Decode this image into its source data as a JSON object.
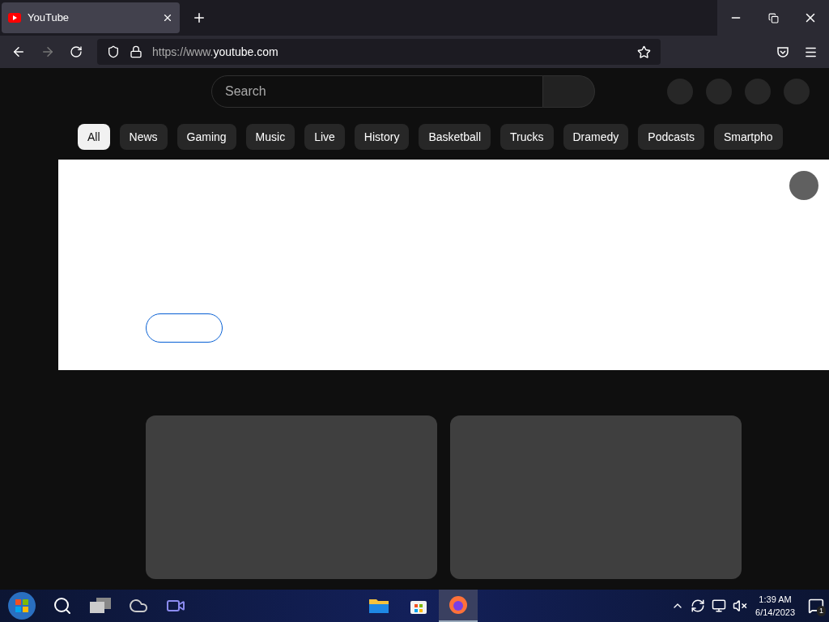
{
  "browser": {
    "tab": {
      "title": "YouTube",
      "selected": true
    },
    "url": {
      "prefix": "https://www.",
      "host": "youtube.com"
    }
  },
  "page": {
    "search": {
      "placeholder": "Search"
    },
    "chips": [
      {
        "label": "All",
        "selected": true
      },
      {
        "label": "News",
        "selected": false
      },
      {
        "label": "Gaming",
        "selected": false
      },
      {
        "label": "Music",
        "selected": false
      },
      {
        "label": "Live",
        "selected": false
      },
      {
        "label": "History",
        "selected": false
      },
      {
        "label": "Basketball",
        "selected": false
      },
      {
        "label": "Trucks",
        "selected": false
      },
      {
        "label": "Dramedy",
        "selected": false
      },
      {
        "label": "Podcasts",
        "selected": false
      },
      {
        "label": "Smartpho",
        "selected": false
      }
    ]
  },
  "taskbar": {
    "apps": [
      {
        "kind": "folder",
        "selected": false
      },
      {
        "kind": "store",
        "selected": false
      },
      {
        "kind": "firefox",
        "selected": true
      }
    ],
    "time": "1:39 AM",
    "date": "6/14/2023",
    "notifications": "1"
  }
}
